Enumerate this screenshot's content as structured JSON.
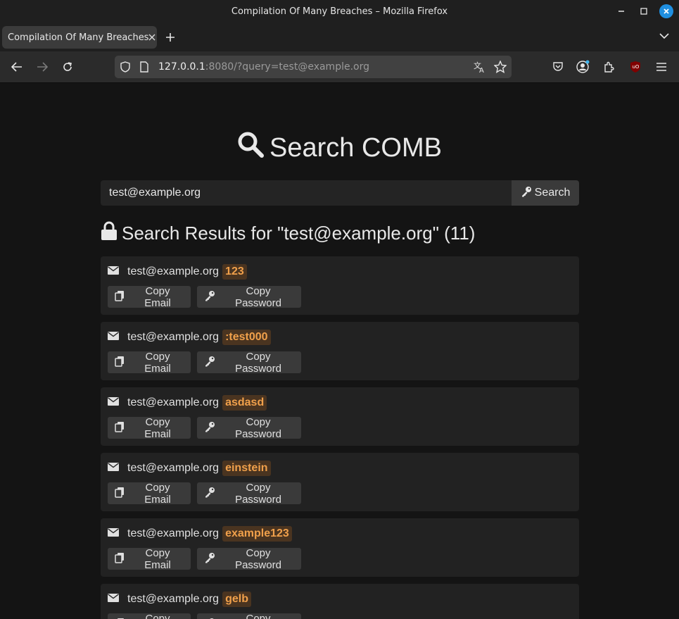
{
  "window": {
    "title": "Compilation Of Many Breaches – Mozilla Firefox"
  },
  "tab": {
    "label": "Compilation Of Many Breaches"
  },
  "url": {
    "host": "127.0.0.1",
    "rest": ":8080/?query=test@example.org"
  },
  "page": {
    "heading": "Search COMB",
    "search": {
      "value": "test@example.org",
      "button_label": "Search"
    },
    "results_title": "Search Results for \"test@example.org\" (11)",
    "results": [
      {
        "email": "test@example.org",
        "password": "123"
      },
      {
        "email": "test@example.org",
        "password": ":test000"
      },
      {
        "email": "test@example.org",
        "password": "asdasd"
      },
      {
        "email": "test@example.org",
        "password": "einstein"
      },
      {
        "email": "test@example.org",
        "password": "example123"
      },
      {
        "email": "test@example.org",
        "password": "gelb"
      }
    ],
    "copy_email_label": "Copy Email",
    "copy_password_label": "Copy Password"
  },
  "colors": {
    "accent_password": "#f0a04b",
    "close_button": "#1f8fe0"
  }
}
